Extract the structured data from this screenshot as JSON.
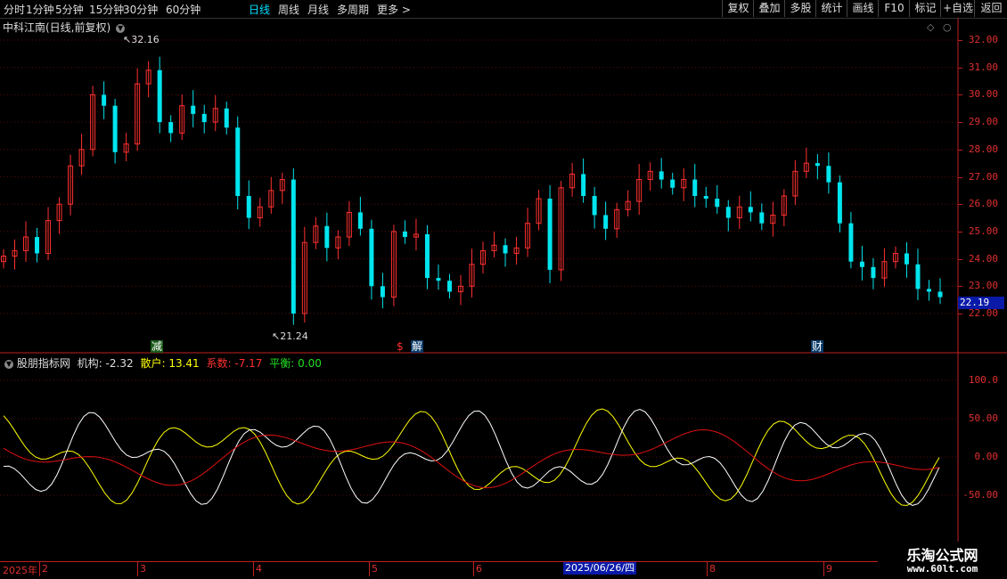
{
  "toolbar": {
    "periods": [
      "分时",
      "1分钟",
      "5分钟",
      "15分钟",
      "30分钟",
      "60分钟",
      "日线",
      "周线",
      "月线",
      "多周期",
      "更多 >"
    ],
    "active_period": "日线",
    "buttons": [
      "复权",
      "叠加",
      "多股",
      "统计",
      "画线",
      "F10",
      "标记",
      "+自选",
      "返回"
    ]
  },
  "chart_title": "中科江南(日线,前复权)",
  "price_axis": [
    "32.00",
    "31.00",
    "30.00",
    "29.00",
    "28.00",
    "27.00",
    "26.00",
    "25.00",
    "24.00",
    "23.00",
    "22.00"
  ],
  "current_price": "22.19",
  "annotations": {
    "high": "32.16",
    "low": "21.24"
  },
  "event_tags": {
    "reduce": "减",
    "unlock": "解",
    "finance": "财",
    "dollar": "$"
  },
  "indicator": {
    "name": "股朋指标网",
    "lines": [
      {
        "label": "机构",
        "value": "-2.32"
      },
      {
        "label": "散户",
        "value": "13.41"
      },
      {
        "label": "系数",
        "value": "-7.17"
      },
      {
        "label": "平衡",
        "value": "0.00"
      }
    ],
    "axis": [
      "100.0",
      "50.00",
      "0.00",
      "-50.00"
    ]
  },
  "date_axis": {
    "year": "2025年",
    "months": [
      "2",
      "3",
      "4",
      "5",
      "6",
      "8",
      "9"
    ],
    "cursor_date": "2025/06/26/四"
  },
  "watermark": {
    "title": "乐淘公式网",
    "url": "www.60lt.com"
  },
  "colors": {
    "up": "#ff3030",
    "down": "#00e5ee",
    "axis": "#c02020",
    "white_line": "#ffffff",
    "yellow_line": "#ffff00",
    "red_line": "#e01010"
  },
  "chart_data": {
    "type": "candlestick",
    "title": "中科江南(日线,前复权)",
    "ylim": [
      21.5,
      32.5
    ],
    "close_series_approx": [
      24.1,
      24.3,
      24.8,
      24.2,
      25.4,
      26.0,
      27.4,
      28.0,
      30.0,
      29.6,
      27.9,
      28.2,
      30.4,
      30.9,
      29.0,
      28.6,
      29.6,
      29.3,
      29.0,
      29.5,
      28.8,
      26.3,
      25.5,
      25.9,
      26.5,
      26.9,
      22.0,
      24.6,
      25.2,
      24.4,
      24.8,
      25.7,
      25.1,
      23.0,
      22.6,
      25.0,
      24.8,
      24.9,
      23.3,
      23.2,
      22.8,
      23.0,
      23.8,
      24.3,
      24.5,
      24.2,
      24.4,
      25.3,
      26.2,
      23.6,
      26.6,
      27.1,
      26.3,
      25.6,
      25.1,
      25.8,
      26.1,
      26.9,
      27.2,
      26.9,
      26.6,
      26.9,
      26.3,
      26.2,
      25.9,
      25.5,
      25.9,
      25.7,
      25.3,
      25.6,
      26.3,
      27.2,
      27.5,
      27.4,
      26.8,
      25.3,
      23.9,
      23.7,
      23.3,
      23.9,
      24.2,
      23.8,
      22.9,
      22.8,
      22.6
    ]
  }
}
